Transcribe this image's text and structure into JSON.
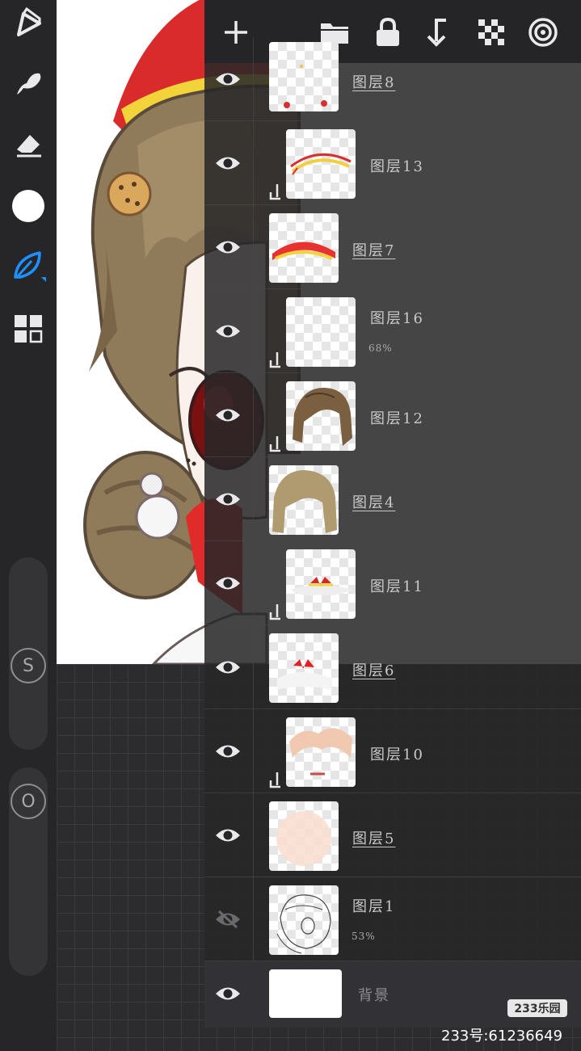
{
  "toolbar": {
    "tools": [
      {
        "name": "brush-library-icon"
      },
      {
        "name": "smudge-icon"
      },
      {
        "name": "eraser-icon"
      },
      {
        "name": "color-picker-icon"
      },
      {
        "name": "leaf-brush-icon",
        "active": true
      },
      {
        "name": "layers-grid-icon"
      }
    ],
    "size_slider_label": "S",
    "opacity_slider_label": "O",
    "accent": "#1e90ff"
  },
  "layer_panel": {
    "header_icons": [
      "add-layer-icon",
      "folder-icon",
      "lock-icon",
      "merge-down-icon",
      "transparency-icon",
      "target-icon"
    ],
    "layers": [
      {
        "name": "图层8",
        "visible": true,
        "clipped": false,
        "opacity": ""
      },
      {
        "name": "图层13",
        "visible": true,
        "clipped": true,
        "opacity": ""
      },
      {
        "name": "图层7",
        "visible": true,
        "clipped": false,
        "opacity": ""
      },
      {
        "name": "图层16",
        "visible": true,
        "clipped": true,
        "opacity": "68%"
      },
      {
        "name": "图层12",
        "visible": true,
        "clipped": true,
        "opacity": ""
      },
      {
        "name": "图层4",
        "visible": true,
        "clipped": false,
        "opacity": ""
      },
      {
        "name": "图层11",
        "visible": true,
        "clipped": true,
        "opacity": ""
      },
      {
        "name": "图层6",
        "visible": true,
        "clipped": false,
        "opacity": ""
      },
      {
        "name": "图层10",
        "visible": true,
        "clipped": true,
        "opacity": ""
      },
      {
        "name": "图层5",
        "visible": true,
        "clipped": false,
        "opacity": ""
      },
      {
        "name": "图层1",
        "visible": false,
        "clipped": false,
        "opacity": "53%"
      },
      {
        "name": "背景",
        "visible": true,
        "clipped": false,
        "opacity": ""
      }
    ]
  },
  "watermark": {
    "logo": "233乐园",
    "id": "233号:61236649"
  }
}
